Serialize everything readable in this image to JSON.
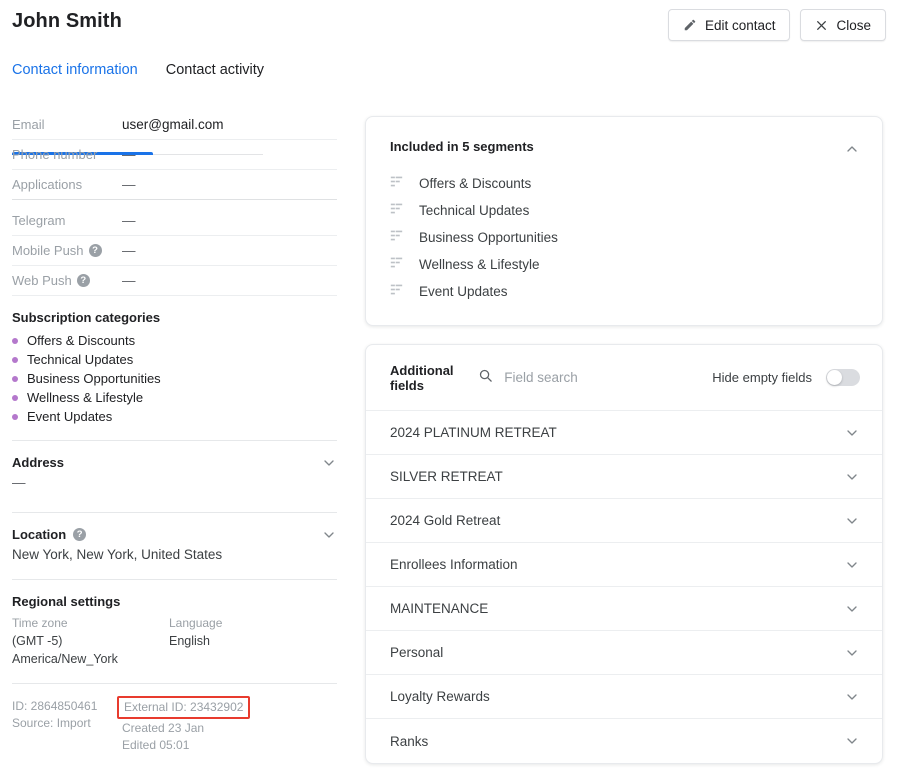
{
  "header": {
    "contact_name": "John Smith",
    "edit_button": "Edit contact",
    "close_button": "Close"
  },
  "tabs": [
    {
      "label": "Contact information",
      "active": true
    },
    {
      "label": "Contact activity",
      "active": false
    }
  ],
  "contact_fields": [
    {
      "label": "Email",
      "value": "user@gmail.com",
      "help": false
    },
    {
      "label": "Phone number",
      "value": "—",
      "help": false
    },
    {
      "label": "Applications",
      "value": "—",
      "help": false
    },
    {
      "label": "Telegram",
      "value": "—",
      "help": false
    },
    {
      "label": "Mobile Push",
      "value": "—",
      "help": true
    },
    {
      "label": "Web Push",
      "value": "—",
      "help": true
    }
  ],
  "subscription": {
    "title": "Subscription categories",
    "dot_color": "#b478cc",
    "items": [
      "Offers & Discounts",
      "Technical Updates",
      "Business Opportunities",
      "Wellness & Lifestyle",
      "Event Updates"
    ]
  },
  "address": {
    "title": "Address",
    "value": "—"
  },
  "location": {
    "title": "Location",
    "value": "New York, New York, United States"
  },
  "regional": {
    "title": "Regional settings",
    "timezone_label": "Time zone",
    "timezone_value": "(GMT -5) America/New_York",
    "language_label": "Language",
    "language_value": "English"
  },
  "meta": {
    "id": "ID: 2864850461",
    "source": "Source:  Import",
    "external_id": "External ID: 23432902",
    "created": "Created 23 Jan",
    "edited": "Edited 05:01",
    "highlight_color": "#e83b2e"
  },
  "segments": {
    "title": "Included in  5  segments",
    "items": [
      "Offers & Discounts",
      "Technical Updates",
      "Business Opportunities",
      "Wellness & Lifestyle",
      "Event Updates"
    ]
  },
  "additional_fields": {
    "title": "Additional fields",
    "search_placeholder": "Field search",
    "search_value": "",
    "hide_empty_label": "Hide empty fields",
    "hide_empty_on": false,
    "groups": [
      "2024 PLATINUM RETREAT",
      "SILVER RETREAT",
      "2024 Gold Retreat",
      "Enrollees Information",
      "MAINTENANCE",
      "Personal",
      "Loyalty Rewards",
      "Ranks"
    ]
  },
  "theme": {
    "accent": "#1a73e8",
    "text": "#202124",
    "muted": "#9aa0a6"
  }
}
